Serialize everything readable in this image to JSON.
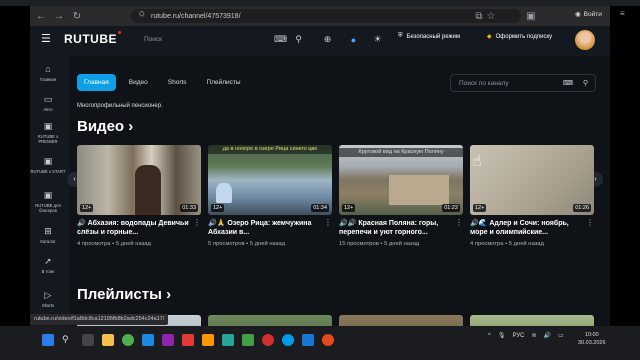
{
  "browser": {
    "url": "rutube.ru/channel/47573918/",
    "login_label": "Войти"
  },
  "header": {
    "logo": "RUTUBE",
    "search_placeholder": "Поиск",
    "safe_mode": "Безопасный режим",
    "subscribe": "Оформить подписку"
  },
  "sidebar": {
    "items": [
      {
        "label": "Главная",
        "icon": "home-icon"
      },
      {
        "label": "Авто",
        "icon": "car-icon"
      },
      {
        "label": "RUTUBE x PREMIER",
        "icon": "premier-icon"
      },
      {
        "label": "RUTUBE x START",
        "icon": "start-icon"
      },
      {
        "label": "RUTUBE для блогеров",
        "icon": "bloggers-icon"
      },
      {
        "label": "Каталог",
        "icon": "catalog-icon"
      },
      {
        "label": "В топе",
        "icon": "rocket-icon"
      },
      {
        "label": "Shorts",
        "icon": "shorts-icon"
      }
    ]
  },
  "channel": {
    "tabs": [
      "Главная",
      "Видео",
      "Shorts",
      "Плейлисты"
    ],
    "active_tab": 0,
    "search_placeholder": "Поиск по каналу",
    "description": "Многопрофильный пенсионер.",
    "videos_title": "Видео",
    "playlists_title": "Плейлисты"
  },
  "videos": [
    {
      "title": "🔊 Абхазия: водопады Девичьи слёзы и горные...",
      "views": "4 просмотра",
      "age": "5 дней назад",
      "duration": "01:33",
      "rating": "12+",
      "overlay": ""
    },
    {
      "title": "🔊🙏 Озеро Рица: жемчужина Абхазии в...",
      "views": "5 просмотров",
      "age": "5 дней назад",
      "duration": "01:34",
      "rating": "12+",
      "overlay": "да в нояоре в озере Рица синего цве"
    },
    {
      "title": "🔊🔊 Красная Поляна: горы, перепечи и уют горного...",
      "views": "15 просмотров",
      "age": "5 дней назад",
      "duration": "01:22",
      "rating": "12+",
      "overlay": "Круговой вид на Красную Поляну"
    },
    {
      "title": "🔊🌊 Адлер и Сочи: ноябрь, море и олимпийские...",
      "views": "4 просмотра",
      "age": "5 дней назад",
      "duration": "01:26",
      "rating": "12+",
      "overlay": ""
    }
  ],
  "status_url": "rutube.ru/video/f1a8dc8ca12195fb8b2adc254c24a17/",
  "taskbar": {
    "lang": "РУС",
    "time": "10:00",
    "date": "30.03.2026"
  }
}
